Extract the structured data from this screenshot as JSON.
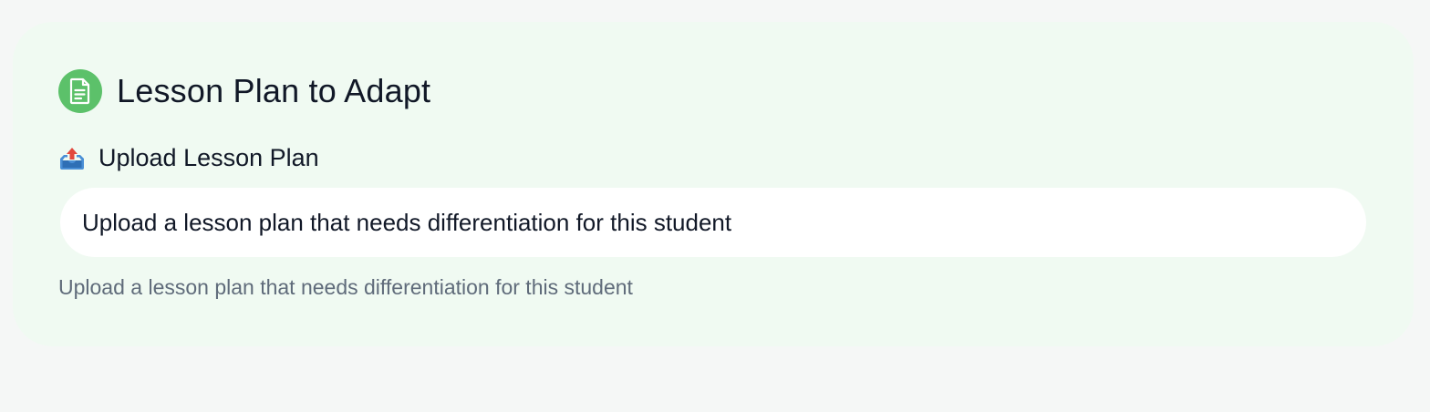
{
  "section": {
    "title": "Lesson Plan to Adapt",
    "title_icon": "document-icon",
    "accent_color": "#5cc16a"
  },
  "upload": {
    "label": "Upload Lesson Plan",
    "label_icon": "outbox-tray-icon",
    "field_text": "Upload a lesson plan that needs differentiation for this student",
    "helper_text": "Upload a lesson plan that needs differentiation for this student"
  }
}
